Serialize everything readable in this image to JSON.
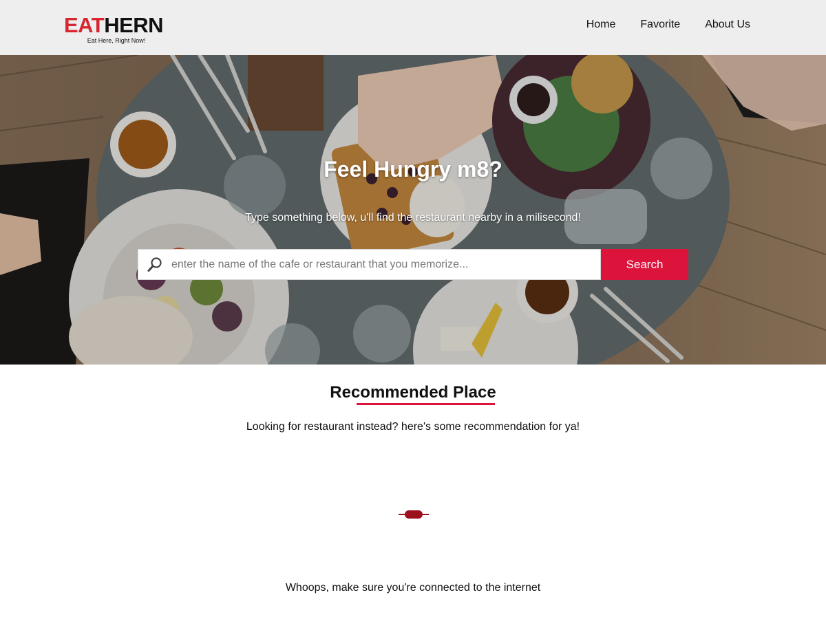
{
  "brand": {
    "logo_part1": "EAT",
    "logo_part2": "HERN",
    "tagline": "Eat Here, Right Now!",
    "accent_color": "#d7262f"
  },
  "nav": {
    "items": [
      {
        "label": "Home"
      },
      {
        "label": "Favorite"
      },
      {
        "label": "About Us"
      }
    ]
  },
  "hero": {
    "title": "Feel Hungry m8?",
    "subtitle": "Type something below, u'll find the restaurant nearby in a milisecond!",
    "background_icon": "food-table-photo"
  },
  "search": {
    "icon": "search-icon",
    "placeholder": "enter the name of the cafe or restaurant that you memorize...",
    "value": "",
    "button_label": "Search",
    "button_color": "#dc143c"
  },
  "recommended": {
    "title": "Recommended Place",
    "subtitle": "Looking for restaurant instead? here's some recommendation for ya!",
    "loading_icon": "loading-spinner-icon",
    "error_message": "Whoops, make sure you're connected to the internet"
  }
}
